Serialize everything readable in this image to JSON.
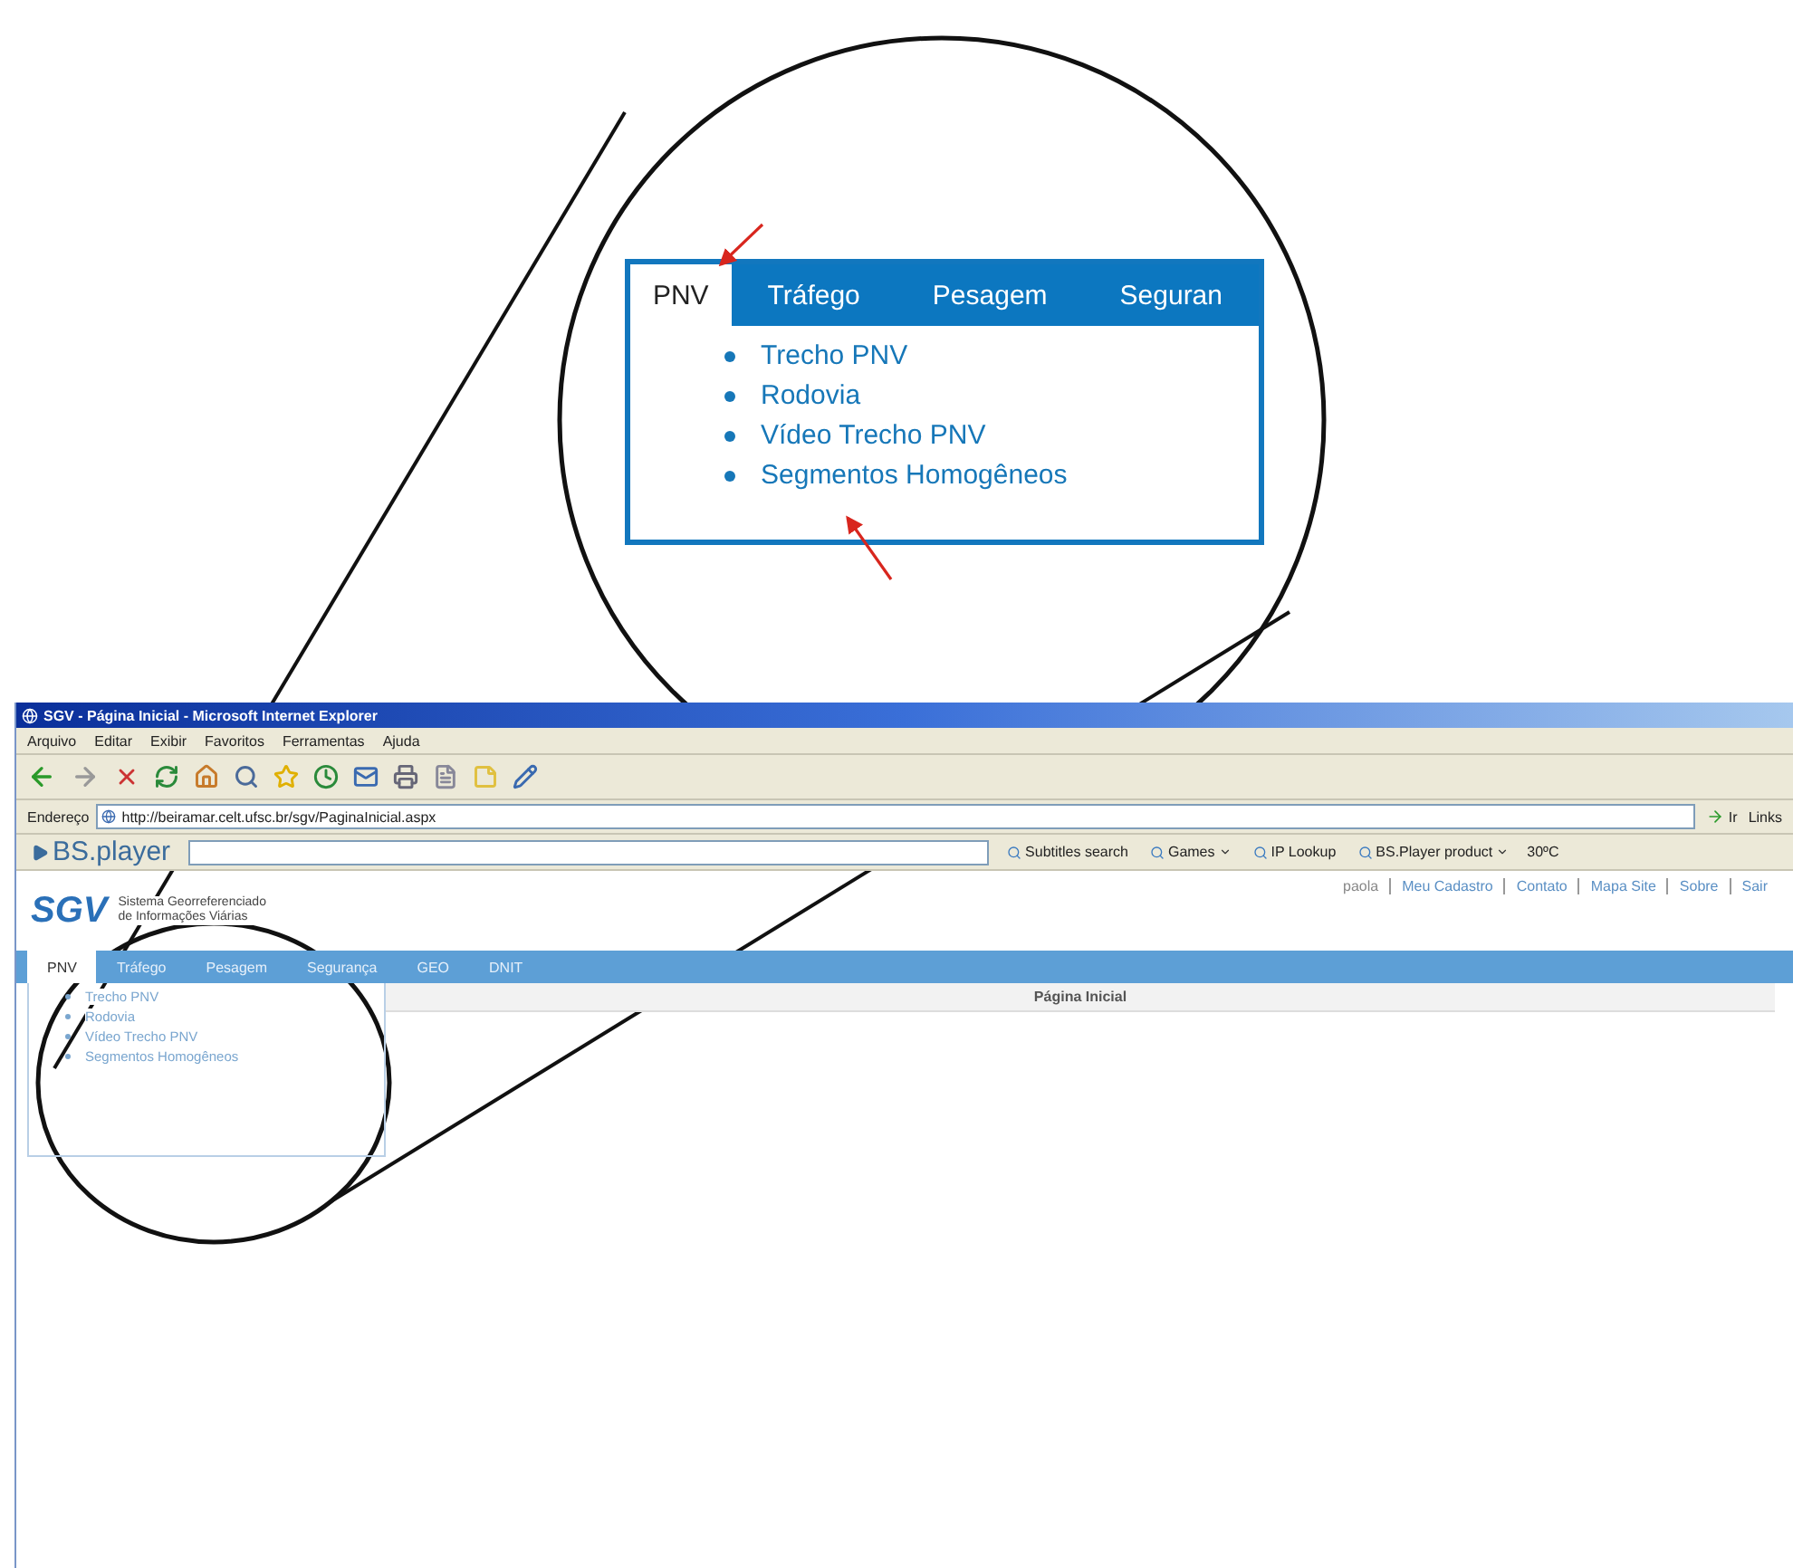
{
  "callout": {
    "tabs": [
      {
        "label": "PNV",
        "selected": true
      },
      {
        "label": "Tráfego",
        "selected": false
      },
      {
        "label": "Pesagem",
        "selected": false
      },
      {
        "label": "Seguran",
        "selected": false
      }
    ],
    "items": [
      "Trecho PNV",
      "Rodovia",
      "Vídeo Trecho PNV",
      "Segmentos Homogêneos"
    ]
  },
  "window": {
    "title": "SGV - Página Inicial - Microsoft Internet Explorer"
  },
  "menu": [
    "Arquivo",
    "Editar",
    "Exibir",
    "Favoritos",
    "Ferramentas",
    "Ajuda"
  ],
  "address": {
    "label": "Endereço",
    "value": "http://beiramar.celt.ufsc.br/sgv/PaginaInicial.aspx",
    "go": "Ir",
    "links": "Links"
  },
  "bsbar": {
    "logo": "BS.player",
    "items": [
      "Subtitles search",
      "Games",
      "IP Lookup",
      "BS.Player product"
    ],
    "weather": "30ºC"
  },
  "site": {
    "logo": "SGV",
    "subtitle": [
      "Sistema Georreferenciado",
      "de Informações Viárias"
    ],
    "user": "paola",
    "links": [
      "Meu Cadastro",
      "Contato",
      "Mapa Site",
      "Sobre",
      "Sair"
    ],
    "tabs": [
      {
        "label": "PNV",
        "selected": true
      },
      {
        "label": "Tráfego",
        "selected": false
      },
      {
        "label": "Pesagem",
        "selected": false
      },
      {
        "label": "Segurança",
        "selected": false
      },
      {
        "label": "GEO",
        "selected": false
      },
      {
        "label": "DNIT",
        "selected": false
      }
    ],
    "menu_items": [
      "Trecho PNV",
      "Rodovia",
      "Vídeo Trecho PNV",
      "Segmentos Homogêneos"
    ],
    "page_title": "Página Inicial"
  }
}
